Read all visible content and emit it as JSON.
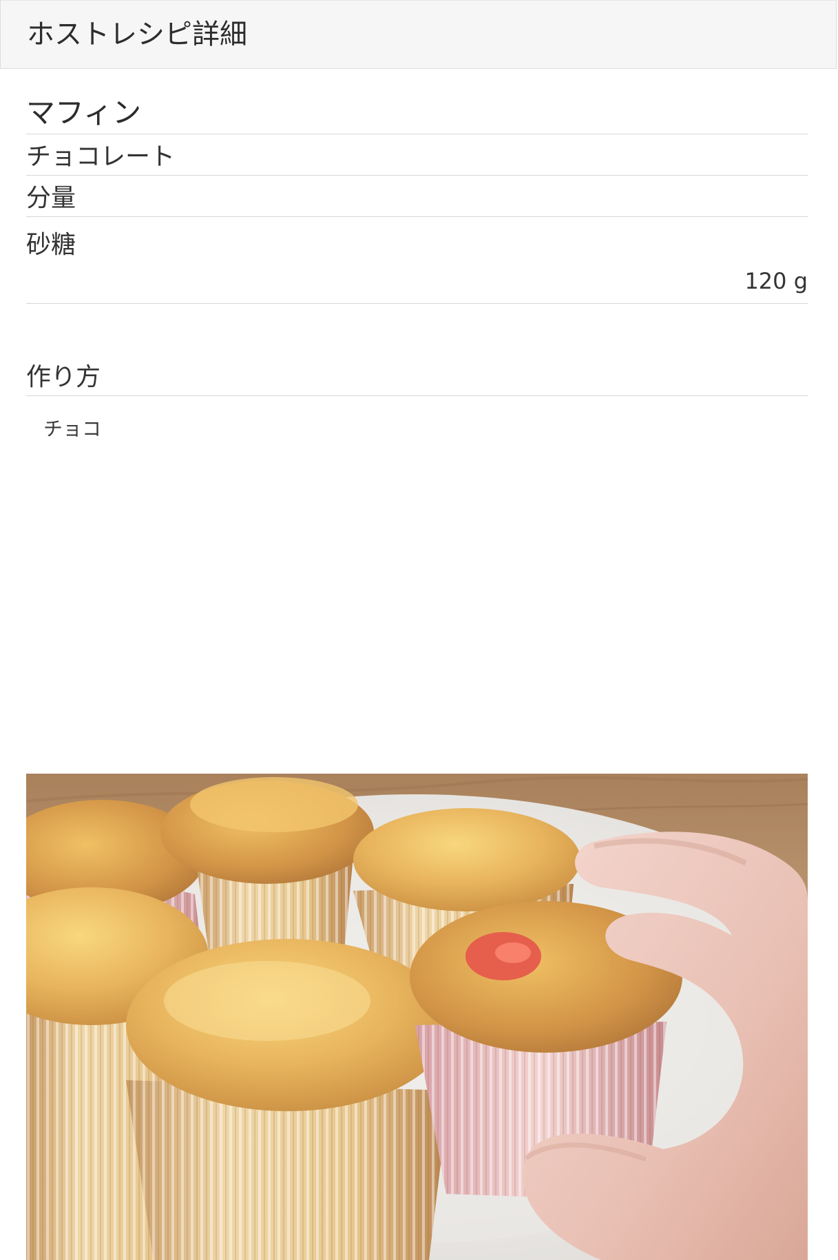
{
  "header": {
    "title": "ホストレシピ詳細"
  },
  "recipe": {
    "name": "マフィン",
    "category": "チョコレート",
    "quantity_heading": "分量",
    "ingredients": [
      {
        "name": "砂糖",
        "amount": "120 g"
      }
    ],
    "method_heading": "作り方",
    "method_text": "チョコ",
    "photo": "muffin-photo"
  },
  "colors": {
    "header_bg": "#f6f6f6",
    "divider": "#d6d6d6",
    "text": "#333333"
  }
}
